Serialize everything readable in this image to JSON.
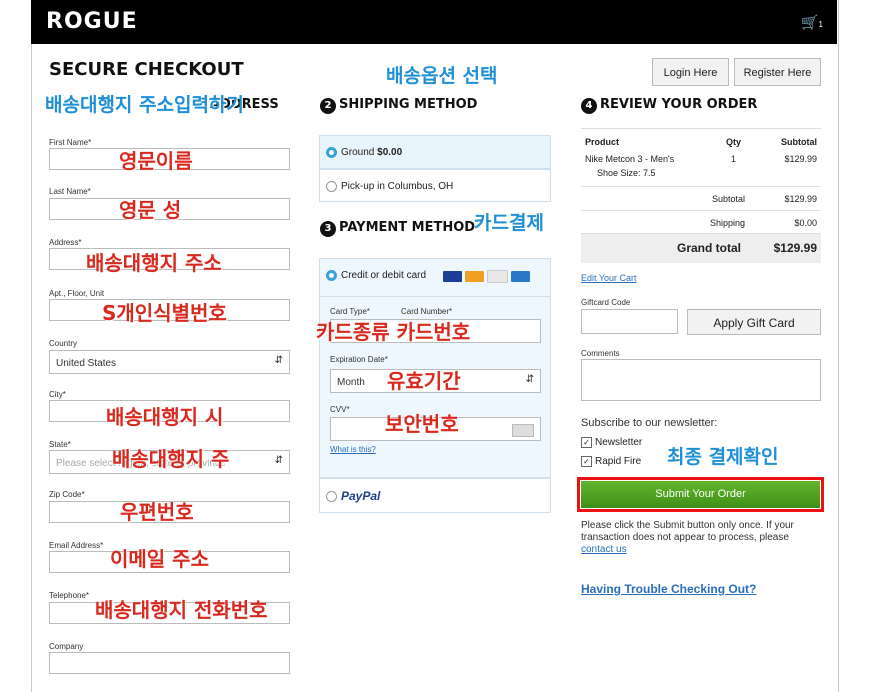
{
  "header": {
    "logo": "ROGUE",
    "cart_count": "1"
  },
  "page_title": "SECURE CHECKOUT",
  "auth": {
    "login": "Login Here",
    "register": "Register Here"
  },
  "address_form": {
    "heading_partial": "ADDRESS",
    "first_name_label": "First Name*",
    "last_name_label": "Last Name*",
    "address_label": "Address*",
    "apt_label": "Apt., Floor, Unit",
    "country_label": "Country",
    "country_value": "United States",
    "city_label": "City*",
    "state_label": "State*",
    "state_placeholder": "Please select region, state or province",
    "zip_label": "Zip Code*",
    "email_label": "Email Address*",
    "telephone_label": "Telephone*",
    "company_label": "Company"
  },
  "shipping": {
    "number": "2",
    "heading": "SHIPPING METHOD",
    "option1_label": "Ground",
    "option1_price": "$0.00",
    "option2_label": "Pick-up in Columbus, OH"
  },
  "payment": {
    "number": "3",
    "heading": "PAYMENT METHOD",
    "card_option": "Credit or debit card",
    "card_type_label": "Card Type*",
    "card_number_label": "Card Number*",
    "expiration_label": "Expiration Date*",
    "month_value": "Month",
    "cvv_label": "CVV*",
    "what_is_this": "What is this?",
    "paypal": "PayPal",
    "card_colors": [
      "#1a3e9a",
      "#f0a020",
      "#e8e8e8",
      "#2a78c8"
    ]
  },
  "review": {
    "number": "4",
    "heading": "REVIEW YOUR ORDER",
    "col_product": "Product",
    "col_qty": "Qty",
    "col_subtotal": "Subtotal",
    "item_name": "Nike Metcon 3 - Men's",
    "item_size": "Shoe Size: 7.5",
    "item_qty": "1",
    "item_subtotal": "$129.99",
    "subtotal_label": "Subtotal",
    "subtotal_value": "$129.99",
    "shipping_label": "Shipping",
    "shipping_value": "$0.00",
    "grand_label": "Grand total",
    "grand_value": "$129.99",
    "edit_cart": "Edit Your Cart",
    "giftcard_label": "Giftcard Code",
    "apply_gift": "Apply Gift Card",
    "comments_label": "Comments",
    "subscribe_label": "Subscribe to our newsletter:",
    "newsletter": "Newsletter",
    "rapid_fire": "Rapid Fire",
    "submit": "Submit Your Order",
    "notice": "Please click the Submit button only once. If your transaction does not appear to process, please",
    "contact_us": "contact us",
    "trouble": "Having Trouble Checking Out?"
  },
  "annotations": {
    "shipping_option": "배송옵션 선택",
    "address_entry": "배송대행지 주소입력하기",
    "english_first": "영문이름",
    "english_last": "영문 성",
    "address": "배송대행지 주소",
    "id_number": "S개인식별번호",
    "city": "배송대행지 시",
    "state": "배송대행지 주",
    "zip": "우편번호",
    "email": "이메일 주소",
    "phone": "배송대행지 전화번호",
    "card_payment": "카드결제",
    "card_type_number": "카드종류  카드번호",
    "expiry": "유효기간",
    "cvv": "보안번호",
    "final_confirm": "최종 결제확인"
  }
}
